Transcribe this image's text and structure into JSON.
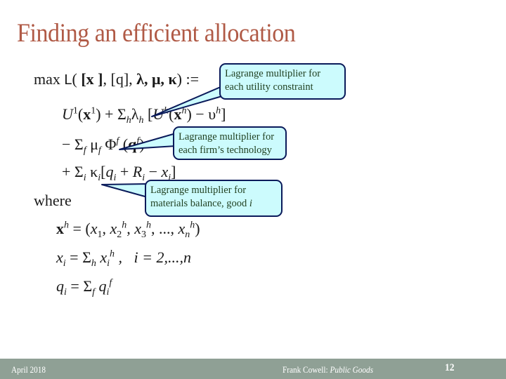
{
  "slide": {
    "title": "Finding an efficient allocation",
    "formula": {
      "lagrangian_head": {
        "max": "max",
        "L": "L",
        "open": "( ",
        "x": "[x ]",
        "sep1": ", ",
        "q": "[q]",
        "sep2": ", ",
        "greek": "λ, μ, κ",
        "close": ") :="
      },
      "line1": {
        "U": "U",
        "U_sup": "1",
        "x_open": "(",
        "x": "x",
        "x_sup": "1",
        "x_close": ") + ",
        "sigma": "Σ",
        "sigma_sub": "h",
        "lambda": "λ",
        "lambda_sub": "h",
        "bracket_open": " [",
        "Uh": "U",
        "Uh_sup": "h",
        "xh_open": "(",
        "xh": "x",
        "xh_sup": "h",
        "xh_close": ") − ",
        "upsilon": "υ",
        "upsilon_sup": "h",
        "bracket_close": "]"
      },
      "line2": {
        "minus": "− ",
        "sigma": "Σ",
        "sigma_sub": "f",
        "mu": " μ",
        "mu_sub": "f",
        "phi": " Φ",
        "phi_sup": "f",
        "q_open": " (",
        "q": "q",
        "q_sup": "f",
        "q_close": ")"
      },
      "line3": {
        "plus": "+ ",
        "sigma": "Σ",
        "sigma_sub": "i",
        "kappa": " κ",
        "kappa_sub": "i",
        "open": "[",
        "q": "q",
        "q_sub": "i",
        "plus2": " + ",
        "R": "R",
        "R_sub": "i",
        "minus": " − ",
        "x": "x",
        "x_sub": "i",
        "close": "]"
      },
      "where": "where",
      "def1": {
        "x": "x",
        "x_sup": "h",
        "eq": " = (",
        "x1": "x",
        "x1_sub": "1",
        "comma1": ", ",
        "x2": "x",
        "x2_sub": "2",
        "x2_sup": "h",
        "comma2": ", ",
        "x3": "x",
        "x3_sub": "3",
        "x3_sup": "h",
        "dots": ", ..., ",
        "xn": "x",
        "xn_sub": "n",
        "xn_sup": "h",
        "close": ")"
      },
      "def2": {
        "x": "x",
        "x_sub": "i",
        "eq": " = ",
        "sigma": "Σ",
        "sigma_sub": "h",
        "xi": " x",
        "xi_sub": "i",
        "xi_sup": "h",
        "range": " ,   i = 2,...,n"
      },
      "def3": {
        "q": "q",
        "q_sub": "i",
        "eq": " = ",
        "sigma": "Σ",
        "sigma_sub": "f",
        "qi": " q",
        "qi_sub": "i",
        "qi_sup": "f"
      }
    },
    "callouts": [
      {
        "line1": "Lagrange multiplier for",
        "line2": "each utility constraint"
      },
      {
        "line1": "Lagrange multiplier for",
        "line2": "each firm’s technology"
      },
      {
        "line1": "Lagrange multiplier for",
        "line2": "materials balance, good ",
        "line2_italic": "i"
      }
    ]
  },
  "footer": {
    "date": "April 2018",
    "author": "Frank Cowell: ",
    "course": "Public Goods",
    "page_number": "12"
  },
  "colors": {
    "title": "#b05a46",
    "callout_fill": "#ccfbfd",
    "callout_border": "#0a1a5a",
    "footer_bg": "#8fa095"
  }
}
